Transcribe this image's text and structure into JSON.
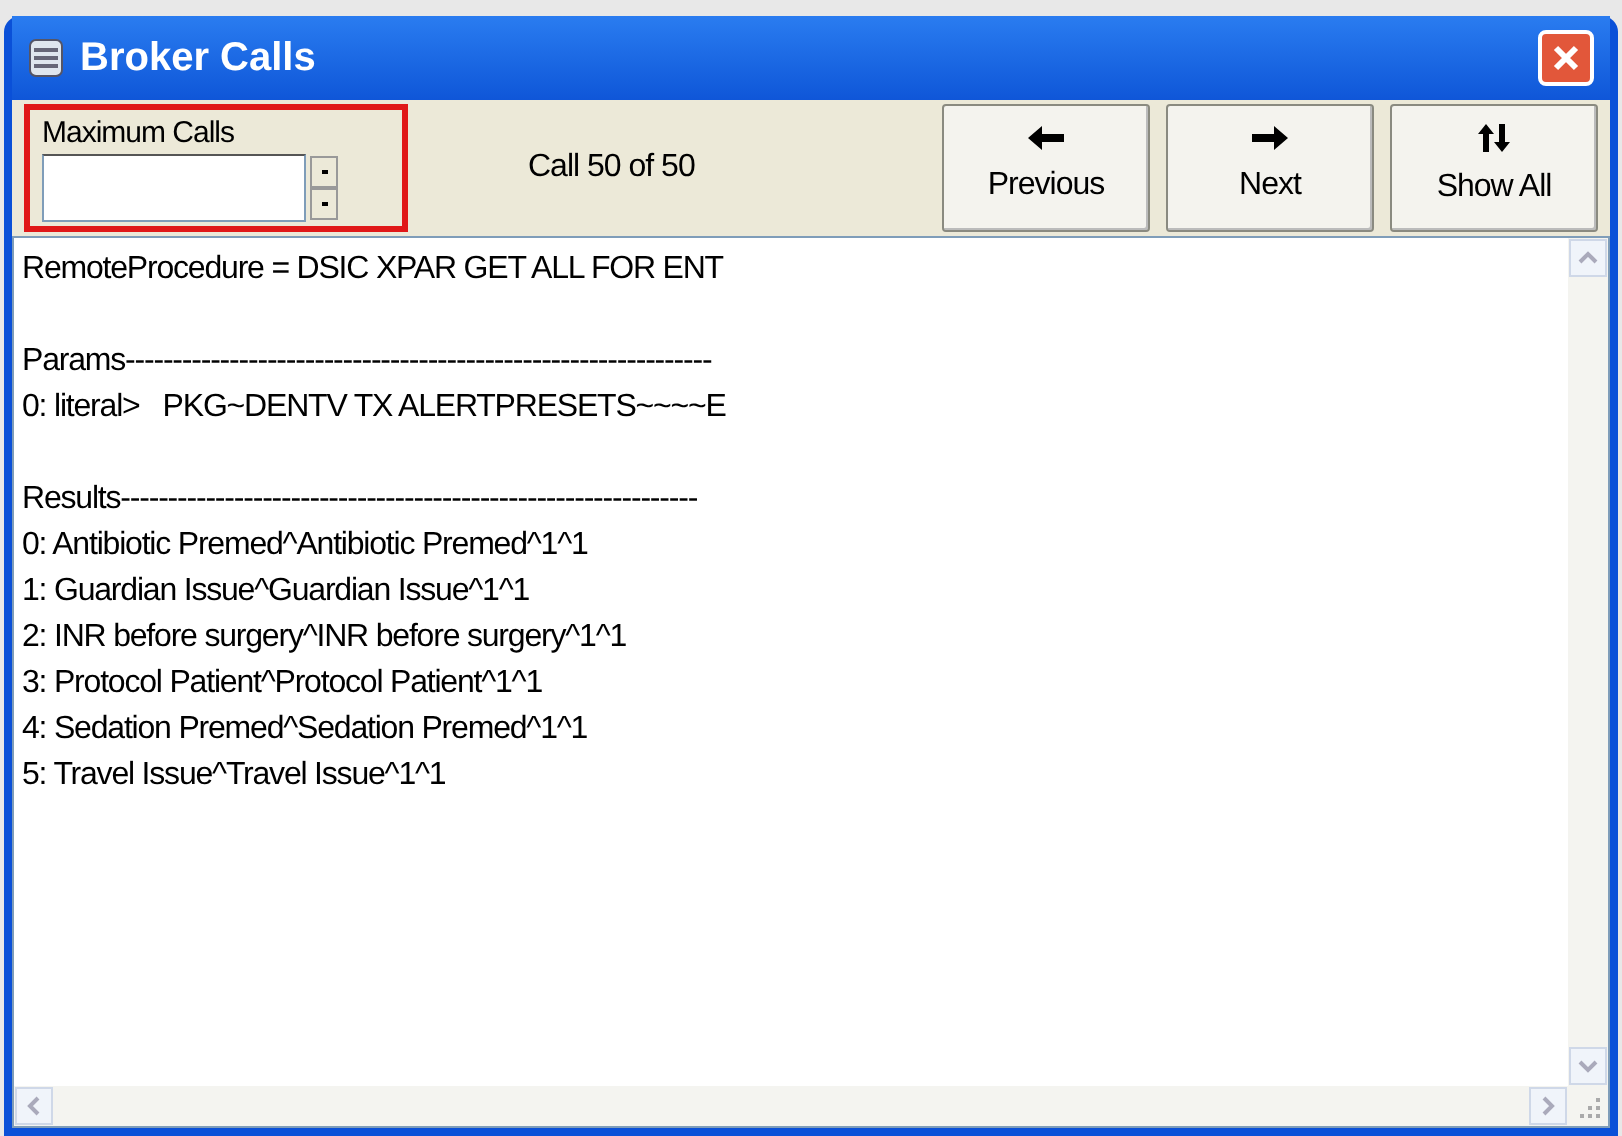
{
  "window": {
    "title": "Broker Calls"
  },
  "max_calls": {
    "label": "Maximum Calls",
    "highlighted": true
  },
  "call_status": "Call 50 of 50",
  "buttons": [
    {
      "label": "Previous",
      "kind": "left"
    },
    {
      "label": "Next",
      "kind": "right"
    },
    {
      "label": "Show All",
      "kind": "updown"
    }
  ],
  "memo_blocks": [
    [
      "RemoteProcedure = DSIC XPAR GET ALL FOR ENT"
    ],
    [
      "Params--------------------------------------------------------------",
      "0: literal>   PKG~DENTV TX ALERTPRESETS~~~~E"
    ],
    [
      "Results-------------------------------------------------------------",
      "0: Antibiotic Premed^Antibiotic Premed^1^1",
      "1: Guardian Issue^Guardian Issue^1^1",
      "2: INR before surgery^INR before surgery^1^1",
      "3: Protocol Patient^Protocol Patient^1^1",
      "4: Sedation Premed^Sedation Premed^1^1",
      "5: Travel Issue^Travel Issue^1^1"
    ]
  ]
}
